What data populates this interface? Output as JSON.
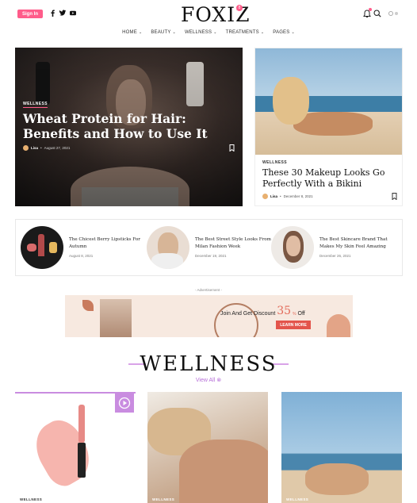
{
  "header": {
    "signin_label": "Sign In",
    "logo": "FOXIZ",
    "logo_badge": "8",
    "social": [
      "f",
      "t",
      "yt"
    ],
    "nav": [
      "HOME",
      "BEAUTY",
      "WELLNESS",
      "TREATMENTS",
      "PAGES"
    ]
  },
  "hero": {
    "category": "WELLNESS",
    "title": "Wheat Protein for Hair: Benefits and How to Use It",
    "author": "Lisa",
    "date": "August 27, 2021"
  },
  "feature": {
    "category": "WELLNESS",
    "title": "These 30 Makeup Looks Go Perfectly With a Bikini",
    "author": "Lisa",
    "date": "December 8, 2021"
  },
  "small_posts": [
    {
      "title": "The Chicest Berry Lipsticks For Autumn",
      "date": "August 8, 2021"
    },
    {
      "title": "The Best Street Style Looks From Milan Fashion Week",
      "date": "December 19, 2021"
    },
    {
      "title": "The Best Skincare Brand That Makes My Skin Feel Amazing",
      "date": "December 26, 2021"
    }
  ],
  "ad": {
    "label": "- Advertisement -",
    "text": "Join And Get Discount",
    "percent": "35",
    "percent_sup": "%",
    "off": "Off",
    "button": "LEARN MORE"
  },
  "section": {
    "title": "WELLNESS",
    "view_all": "View All"
  },
  "bottom_cards": [
    {
      "category": "WELLNESS"
    },
    {
      "category": "WELLNESS"
    },
    {
      "category": "WELLNESS"
    }
  ],
  "colors": {
    "accent_pink": "#ff5c8a",
    "accent_purple": "#c98ce0",
    "link_purple": "#b66fd8",
    "ad_button": "#e3544b"
  }
}
